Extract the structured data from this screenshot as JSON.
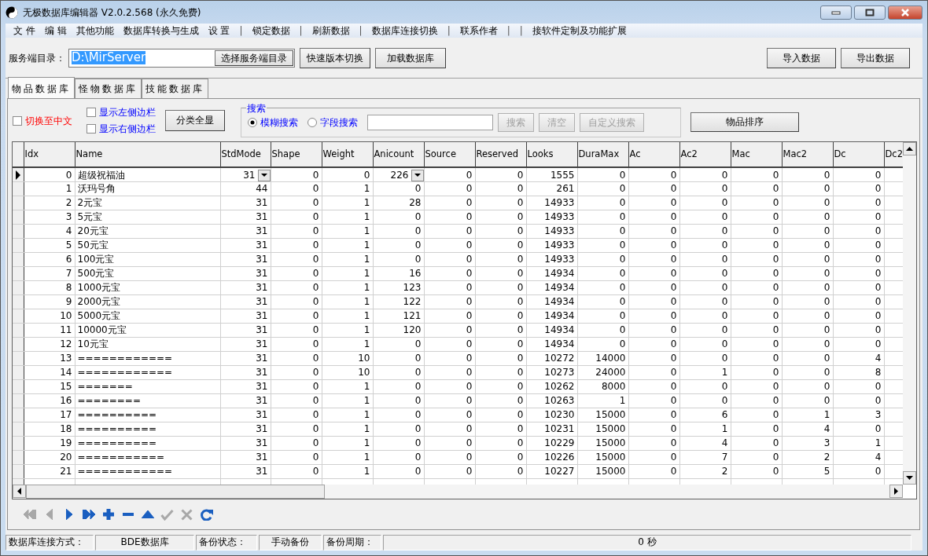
{
  "window": {
    "title": "无极数据库编辑器 V2.0.2.568 (永久免费)"
  },
  "menu": [
    {
      "label": "文 件",
      "kind": "item"
    },
    {
      "label": "编 辑",
      "kind": "item"
    },
    {
      "label": "其他功能",
      "kind": "item"
    },
    {
      "label": "数据库转换与生成",
      "kind": "item"
    },
    {
      "label": "设 置",
      "kind": "item"
    },
    {
      "label": "|",
      "kind": "separator"
    },
    {
      "label": "锁定数据",
      "kind": "item"
    },
    {
      "label": "|",
      "kind": "separator"
    },
    {
      "label": "刷新数据",
      "kind": "item"
    },
    {
      "label": "|",
      "kind": "separator"
    },
    {
      "label": "数据库连接切换",
      "kind": "item"
    },
    {
      "label": "|",
      "kind": "separator"
    },
    {
      "label": "联系作者",
      "kind": "item"
    },
    {
      "label": "|",
      "kind": "separator"
    },
    {
      "label": "|",
      "kind": "separator"
    },
    {
      "label": "接软件定制及功能扩展",
      "kind": "item"
    }
  ],
  "server_dir": {
    "label": "服务端目录：",
    "value": "D:\\MirServer",
    "button": "选择服务端目录"
  },
  "toolbar_buttons": [
    "快速版本切换",
    "加载数据库"
  ],
  "data_buttons": [
    "导入数据",
    "导出数据"
  ],
  "tabs": [
    {
      "label": "物品数据库",
      "selected": true
    },
    {
      "label": "怪物数据库",
      "selected": false
    },
    {
      "label": "技能数据库",
      "selected": false
    }
  ],
  "options": [
    {
      "label": "切换至中文",
      "checked": false,
      "kind": "language"
    },
    {
      "label": "显示左侧边栏",
      "checked": false,
      "kind": "panel"
    },
    {
      "label": "显示右侧边栏",
      "checked": false,
      "kind": "panel"
    }
  ],
  "show_all_button": "分类全显",
  "search": {
    "title": "搜索",
    "modes": [
      {
        "label": "模糊搜索",
        "selected": true
      },
      {
        "label": "字段搜索",
        "selected": false
      }
    ],
    "buttons": [
      {
        "label": "搜索",
        "disabled": true
      },
      {
        "label": "清空",
        "disabled": true
      },
      {
        "label": "自定义搜索",
        "disabled": true
      }
    ]
  },
  "sort_button": "物品排序",
  "table": {
    "columns": [
      {
        "label": "Idx",
        "kind": "number"
      },
      {
        "label": "Name",
        "kind": "text"
      },
      {
        "label": "StdMode",
        "kind": "lookup"
      },
      {
        "label": "Shape",
        "kind": "number"
      },
      {
        "label": "Weight",
        "kind": "number"
      },
      {
        "label": "Anicount",
        "kind": "lookup"
      },
      {
        "label": "Source",
        "kind": "number"
      },
      {
        "label": "Reserved",
        "kind": "number"
      },
      {
        "label": "Looks",
        "kind": "number"
      },
      {
        "label": "DuraMax",
        "kind": "number"
      },
      {
        "label": "Ac",
        "kind": "number"
      },
      {
        "label": "Ac2",
        "kind": "number"
      },
      {
        "label": "Mac",
        "kind": "number"
      },
      {
        "label": "Mac2",
        "kind": "number"
      },
      {
        "label": "Dc",
        "kind": "number"
      },
      {
        "label": "Dc2",
        "kind": "number"
      }
    ],
    "rows": [
      {
        "selected": true,
        "cells": [
          "0",
          "超级祝福油",
          "31",
          "0",
          "0",
          "226",
          "0",
          "0",
          "1555",
          "0",
          "0",
          "0",
          "0",
          "0",
          "0"
        ]
      },
      {
        "selected": false,
        "cells": [
          "1",
          "沃玛号角",
          "44",
          "0",
          "1",
          "0",
          "0",
          "0",
          "261",
          "0",
          "0",
          "0",
          "0",
          "0",
          "0"
        ]
      },
      {
        "selected": false,
        "cells": [
          "2",
          "2元宝",
          "31",
          "0",
          "1",
          "28",
          "0",
          "0",
          "14933",
          "0",
          "0",
          "0",
          "0",
          "0",
          "0"
        ]
      },
      {
        "selected": false,
        "cells": [
          "3",
          "5元宝",
          "31",
          "0",
          "1",
          "0",
          "0",
          "0",
          "14933",
          "0",
          "0",
          "0",
          "0",
          "0",
          "0"
        ]
      },
      {
        "selected": false,
        "cells": [
          "4",
          "20元宝",
          "31",
          "0",
          "1",
          "0",
          "0",
          "0",
          "14933",
          "0",
          "0",
          "0",
          "0",
          "0",
          "0"
        ]
      },
      {
        "selected": false,
        "cells": [
          "5",
          "50元宝",
          "31",
          "0",
          "1",
          "0",
          "0",
          "0",
          "14933",
          "0",
          "0",
          "0",
          "0",
          "0",
          "0"
        ]
      },
      {
        "selected": false,
        "cells": [
          "6",
          "100元宝",
          "31",
          "0",
          "1",
          "0",
          "0",
          "0",
          "14933",
          "0",
          "0",
          "0",
          "0",
          "0",
          "0"
        ]
      },
      {
        "selected": false,
        "cells": [
          "7",
          "500元宝",
          "31",
          "0",
          "1",
          "16",
          "0",
          "0",
          "14934",
          "0",
          "0",
          "0",
          "0",
          "0",
          "0"
        ]
      },
      {
        "selected": false,
        "cells": [
          "8",
          "1000元宝",
          "31",
          "0",
          "1",
          "123",
          "0",
          "0",
          "14934",
          "0",
          "0",
          "0",
          "0",
          "0",
          "0"
        ]
      },
      {
        "selected": false,
        "cells": [
          "9",
          "2000元宝",
          "31",
          "0",
          "1",
          "122",
          "0",
          "0",
          "14934",
          "0",
          "0",
          "0",
          "0",
          "0",
          "0"
        ]
      },
      {
        "selected": false,
        "cells": [
          "10",
          "5000元宝",
          "31",
          "0",
          "1",
          "121",
          "0",
          "0",
          "14934",
          "0",
          "0",
          "0",
          "0",
          "0",
          "0"
        ]
      },
      {
        "selected": false,
        "cells": [
          "11",
          "10000元宝",
          "31",
          "0",
          "1",
          "120",
          "0",
          "0",
          "14934",
          "0",
          "0",
          "0",
          "0",
          "0",
          "0"
        ]
      },
      {
        "selected": false,
        "cells": [
          "12",
          "10元宝",
          "31",
          "0",
          "1",
          "0",
          "0",
          "0",
          "14934",
          "0",
          "0",
          "0",
          "0",
          "0",
          "0"
        ]
      },
      {
        "selected": false,
        "cells": [
          "13",
          "============",
          "31",
          "0",
          "10",
          "0",
          "0",
          "0",
          "10272",
          "14000",
          "0",
          "0",
          "0",
          "0",
          "4"
        ]
      },
      {
        "selected": false,
        "cells": [
          "14",
          "============",
          "31",
          "0",
          "10",
          "0",
          "0",
          "0",
          "10273",
          "24000",
          "0",
          "1",
          "0",
          "0",
          "8"
        ]
      },
      {
        "selected": false,
        "cells": [
          "15",
          "=======",
          "31",
          "0",
          "1",
          "0",
          "0",
          "0",
          "10262",
          "8000",
          "0",
          "0",
          "0",
          "0",
          "0"
        ]
      },
      {
        "selected": false,
        "cells": [
          "16",
          "========",
          "31",
          "0",
          "1",
          "0",
          "0",
          "0",
          "10263",
          "1",
          "0",
          "0",
          "0",
          "0",
          "0"
        ]
      },
      {
        "selected": false,
        "cells": [
          "17",
          "==========",
          "31",
          "0",
          "1",
          "0",
          "0",
          "0",
          "10230",
          "15000",
          "0",
          "6",
          "0",
          "1",
          "3"
        ]
      },
      {
        "selected": false,
        "cells": [
          "18",
          "==========",
          "31",
          "0",
          "1",
          "0",
          "0",
          "0",
          "10231",
          "15000",
          "0",
          "1",
          "0",
          "4",
          "0"
        ]
      },
      {
        "selected": false,
        "cells": [
          "19",
          "==========",
          "31",
          "0",
          "1",
          "0",
          "0",
          "0",
          "10229",
          "15000",
          "0",
          "4",
          "0",
          "3",
          "1"
        ]
      },
      {
        "selected": false,
        "cells": [
          "20",
          "===========",
          "31",
          "0",
          "1",
          "0",
          "0",
          "0",
          "10226",
          "15000",
          "0",
          "7",
          "0",
          "2",
          "4"
        ]
      },
      {
        "selected": false,
        "cells": [
          "21",
          "============",
          "31",
          "0",
          "1",
          "0",
          "0",
          "0",
          "10227",
          "15000",
          "0",
          "2",
          "0",
          "5",
          "0"
        ]
      }
    ]
  },
  "navigator": [
    {
      "kind": "first",
      "disabled": true
    },
    {
      "kind": "prior",
      "disabled": true
    },
    {
      "kind": "next",
      "disabled": false
    },
    {
      "kind": "last",
      "disabled": false
    },
    {
      "kind": "insert",
      "disabled": false
    },
    {
      "kind": "delete",
      "disabled": false
    },
    {
      "kind": "edit",
      "disabled": false
    },
    {
      "kind": "post",
      "disabled": true
    },
    {
      "kind": "cancel",
      "disabled": true
    },
    {
      "kind": "refresh",
      "disabled": false
    }
  ],
  "status_bar": [
    "数据库连接方式：",
    "BDE数据库",
    "备份状态：",
    "手动备份",
    "备份周期：",
    "0 秒"
  ]
}
